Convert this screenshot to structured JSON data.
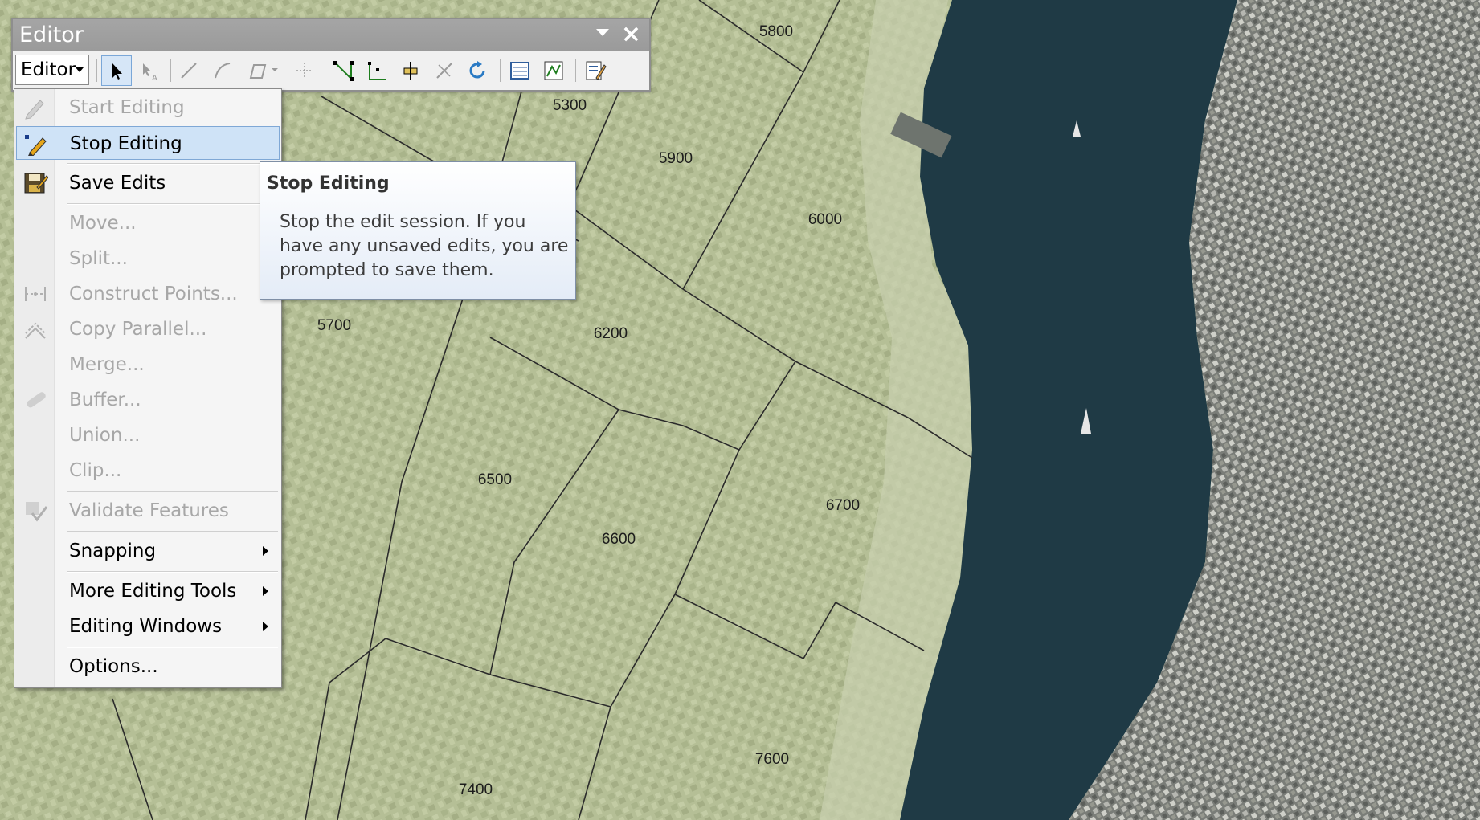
{
  "map": {
    "labels": [
      {
        "name": "map-label-5800",
        "text": "5800"
      },
      {
        "name": "map-label-5300",
        "text": "5300"
      },
      {
        "name": "map-label-5900",
        "text": "5900"
      },
      {
        "name": "map-label-6000",
        "text": "6000"
      },
      {
        "name": "map-label-5700",
        "text": "5700"
      },
      {
        "name": "map-label-6200",
        "text": "6200"
      },
      {
        "name": "map-label-6500",
        "text": "6500"
      },
      {
        "name": "map-label-6700",
        "text": "6700"
      },
      {
        "name": "map-label-6600",
        "text": "6600"
      },
      {
        "name": "map-label-7600",
        "text": "7600"
      },
      {
        "name": "map-label-7400",
        "text": "7400"
      }
    ]
  },
  "editor_window": {
    "title": "Editor",
    "menu_button_label": "Editor",
    "tools": [
      "edit-tool-icon",
      "annotation-edit-tool-icon",
      "straight-segment-icon",
      "end-point-arc-icon",
      "trace-tool-icon",
      "point-tool-icon",
      "edit-vertices-icon",
      "reshape-feature-icon",
      "cut-polygons-icon",
      "split-tool-icon",
      "rotate-tool-icon",
      "attributes-icon",
      "sketch-properties-icon",
      "create-features-icon"
    ]
  },
  "menu": {
    "items": [
      {
        "label": "Start Editing",
        "enabled": false,
        "icon": "pencil-icon"
      },
      {
        "label": "Stop Editing",
        "enabled": true,
        "icon": "stop-editing-icon",
        "highlighted": true
      },
      {
        "label": "Save Edits",
        "enabled": true,
        "icon": "save-edits-icon"
      },
      {
        "label": "Move...",
        "enabled": false
      },
      {
        "label": "Split...",
        "enabled": false
      },
      {
        "label": "Construct Points...",
        "enabled": false,
        "icon": "construct-points-icon"
      },
      {
        "label": "Copy Parallel...",
        "enabled": false,
        "icon": "copy-parallel-icon"
      },
      {
        "label": "Merge...",
        "enabled": false
      },
      {
        "label": "Buffer...",
        "enabled": false,
        "icon": "buffer-icon"
      },
      {
        "label": "Union...",
        "enabled": false
      },
      {
        "label": "Clip...",
        "enabled": false
      },
      {
        "label": "Validate Features",
        "enabled": false,
        "icon": "validate-features-icon"
      },
      {
        "label": "Snapping",
        "enabled": true,
        "submenu": true
      },
      {
        "label": "More Editing Tools",
        "enabled": true,
        "submenu": true
      },
      {
        "label": "Editing Windows",
        "enabled": true,
        "submenu": true
      },
      {
        "label": "Options...",
        "enabled": true
      }
    ]
  },
  "tooltip": {
    "title": "Stop Editing",
    "body": "Stop the edit session. If you have any unsaved edits, you are prompted to save them."
  },
  "colors": {
    "map_land": "#b9c39a",
    "river": "#1f3a45",
    "menu_highlight": "#cfe3f7",
    "disabled_text": "#a7a7a7"
  }
}
